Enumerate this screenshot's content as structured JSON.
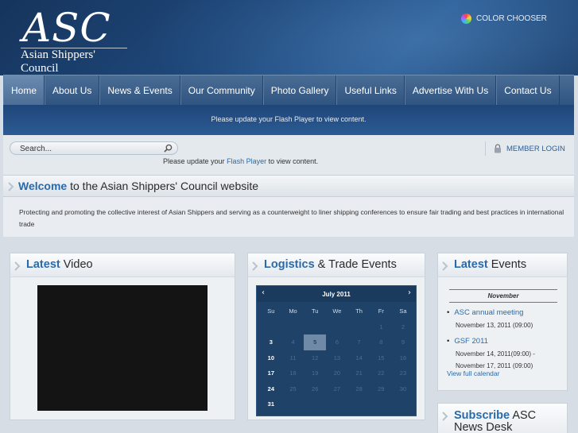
{
  "header": {
    "logo_text": "ASC",
    "logo_subtitle": "Asian Shippers' Council",
    "color_chooser_label": "COLOR CHOOSER"
  },
  "nav": {
    "items": [
      {
        "label": "Home",
        "active": true
      },
      {
        "label": "About Us"
      },
      {
        "label": "News & Events"
      },
      {
        "label": "Our Community"
      },
      {
        "label": "Photo Gallery"
      },
      {
        "label": "Useful Links"
      },
      {
        "label": "Advertise With Us"
      },
      {
        "label": "Contact Us"
      }
    ]
  },
  "flash_banner": {
    "text": "Please update your Flash Player to view content."
  },
  "search": {
    "placeholder": "Search..."
  },
  "flash_notice": {
    "before": "Please update your ",
    "link": "Flash Player",
    "after": " to view content."
  },
  "member_login": {
    "label": "MEMBER LOGIN"
  },
  "welcome": {
    "highlight": "Welcome",
    "rest": " to the Asian Shippers' Council website",
    "intro": "Protecting and promoting the collective interest of Asian Shippers and serving as a counterweight to liner shipping conferences to ensure fair trading and best practices in international trade"
  },
  "video_panel": {
    "highlight": "Latest",
    "rest": " Video"
  },
  "events_panel": {
    "highlight": "Logistics",
    "rest": " & Trade Events",
    "calendar": {
      "month": "July 2011",
      "prev": "‹",
      "next": "›",
      "weekdays": [
        "Su",
        "Mo",
        "Tu",
        "We",
        "Th",
        "Fr",
        "Sa"
      ],
      "weeks": [
        [
          "",
          "",
          "",
          "",
          "",
          "1",
          "2"
        ],
        [
          "3",
          "4",
          "5",
          "6",
          "7",
          "8",
          "9"
        ],
        [
          "10",
          "11",
          "12",
          "13",
          "14",
          "15",
          "16"
        ],
        [
          "17",
          "18",
          "19",
          "20",
          "21",
          "22",
          "23"
        ],
        [
          "24",
          "25",
          "26",
          "27",
          "28",
          "29",
          "30"
        ],
        [
          "31",
          "",
          "",
          "",
          "",
          "",
          ""
        ]
      ],
      "today": "5",
      "bright_days": [
        "3",
        "10",
        "17",
        "24",
        "31"
      ]
    }
  },
  "latest_events": {
    "highlight": "Latest",
    "rest": " Events",
    "month": "November",
    "items": [
      {
        "name": "ASC annual meeting",
        "date": "November 13, 2011 (09:00)"
      },
      {
        "name": "GSF 2011",
        "date": "November 14, 2011(09:00) - November 17, 2011 (09:00)"
      }
    ],
    "view_all": "View full calendar"
  },
  "subscribe": {
    "highlight": "Subscribe",
    "rest": " ASC News Desk"
  }
}
